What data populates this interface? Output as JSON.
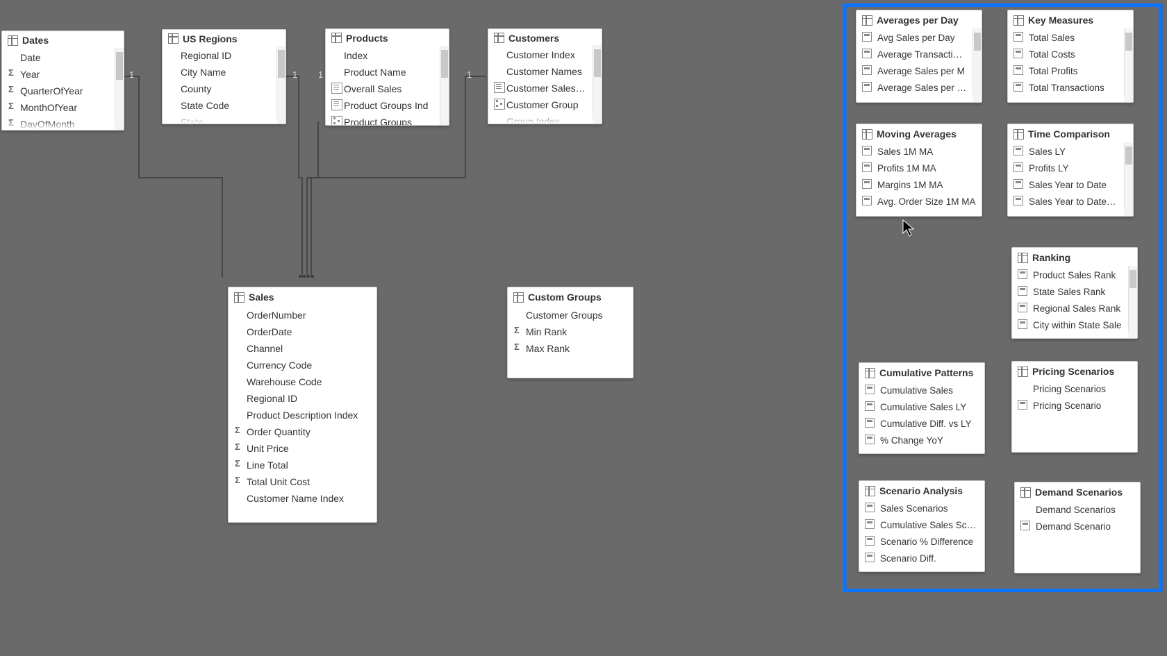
{
  "tables": {
    "dates": {
      "title": "Dates",
      "fields": [
        "Date",
        "Year",
        "QuarterOfYear",
        "MonthOfYear",
        "DayOfMonth"
      ],
      "icons": [
        "",
        "sigma",
        "sigma",
        "sigma",
        "sigma"
      ]
    },
    "regions": {
      "title": "US Regions",
      "fields": [
        "Regional ID",
        "City Name",
        "County",
        "State Code",
        "State"
      ],
      "icons": [
        "",
        "",
        "",
        "",
        ""
      ]
    },
    "products": {
      "title": "Products",
      "fields": [
        "Index",
        "Product Name",
        "Overall Sales",
        "Product Groups Ind",
        "Product Groups"
      ],
      "icons": [
        "",
        "",
        "page",
        "page",
        "hier"
      ]
    },
    "customers": {
      "title": "Customers",
      "fields": [
        "Customer Index",
        "Customer Names",
        "Customer Sales Ra",
        "Customer Group",
        "Group Index"
      ],
      "icons": [
        "",
        "",
        "page",
        "hier",
        ""
      ]
    },
    "sales": {
      "title": "Sales",
      "fields": [
        "OrderNumber",
        "OrderDate",
        "Channel",
        "Currency Code",
        "Warehouse Code",
        "Regional ID",
        "Product Description Index",
        "Order Quantity",
        "Unit Price",
        "Line Total",
        "Total Unit Cost",
        "Customer Name Index"
      ],
      "icons": [
        "",
        "",
        "",
        "",
        "",
        "",
        "",
        "sigma",
        "sigma",
        "sigma",
        "sigma",
        ""
      ]
    },
    "custom": {
      "title": "Custom Groups",
      "fields": [
        "Customer Groups",
        "Min Rank",
        "Max Rank"
      ],
      "icons": [
        "",
        "sigma",
        "sigma"
      ]
    }
  },
  "measure_groups": {
    "avg": {
      "title": "Averages per Day",
      "fields": [
        "Avg Sales per Day",
        "Average Transactions",
        "Average Sales per M",
        "Average Sales per Cu"
      ]
    },
    "key": {
      "title": "Key Measures",
      "fields": [
        "Total Sales",
        "Total Costs",
        "Total Profits",
        "Total Transactions"
      ]
    },
    "mavg": {
      "title": "Moving Averages",
      "fields": [
        "Sales 1M MA",
        "Profits 1M MA",
        "Margins 1M MA",
        "Avg. Order Size 1M MA"
      ]
    },
    "tcomp": {
      "title": "Time Comparison",
      "fields": [
        "Sales LY",
        "Profits LY",
        "Sales Year to Date",
        "Sales Year to Date LY"
      ]
    },
    "rank": {
      "title": "Ranking",
      "fields": [
        "Product Sales Rank",
        "State Sales Rank",
        "Regional Sales Rank",
        "City within State Sale"
      ]
    },
    "cpat": {
      "title": "Cumulative Patterns",
      "fields": [
        "Cumulative Sales",
        "Cumulative Sales LY",
        "Cumulative Diff. vs LY",
        "% Change YoY"
      ]
    },
    "price": {
      "title": "Pricing Scenarios",
      "fields": [
        "Pricing Scenarios",
        "Pricing Scenario"
      ]
    },
    "scen": {
      "title": "Scenario Analysis",
      "fields": [
        "Sales Scenarios",
        "Cumulative Sales Scena",
        "Scenario % Difference",
        "Scenario Diff."
      ]
    },
    "dem": {
      "title": "Demand Scenarios",
      "fields": [
        "Demand Scenarios",
        "Demand Scenario"
      ]
    }
  },
  "cardinalities": {
    "one": "1",
    "many": "*"
  }
}
